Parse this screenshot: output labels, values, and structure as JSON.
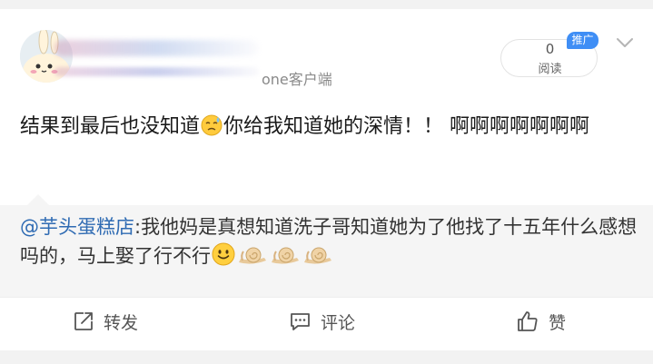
{
  "header": {
    "source_suffix": "one客户端",
    "read_count": "0",
    "read_label": "阅读",
    "promo_badge": "推广"
  },
  "post": {
    "text_part1": "结果到最后也没知道",
    "text_part2": "你给我知道她的深情！！ 啊啊啊啊啊啊啊",
    "emoji_name": "sweat-face"
  },
  "repost": {
    "mention": "@芋头蛋糕店",
    "text": ":我他妈是真想知道洗子哥知道她为了他找了十五年什么感想吗的，马上娶了行不行",
    "emojis": [
      "smile-face",
      "snail",
      "snail",
      "snail"
    ]
  },
  "actions": {
    "share_label": "转发",
    "comment_label": "评论",
    "like_label": "赞"
  }
}
